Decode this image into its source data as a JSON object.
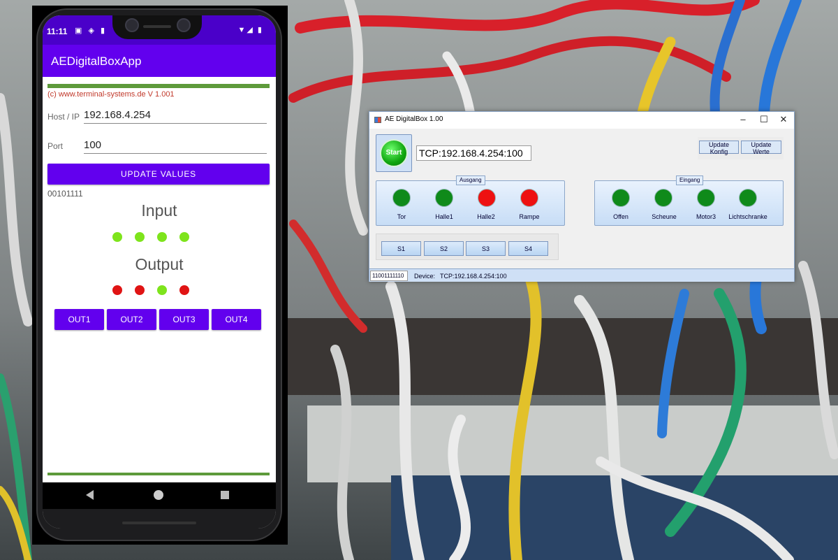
{
  "phone": {
    "status_time": "11:11",
    "status_icons_left": "▣ ◈ ▮",
    "status_icons_right": "▼◢ ▮",
    "app_title": "AEDigitalBoxApp",
    "copyright": "(c) www.terminal-systems.de V 1.001",
    "host_label": "Host / IP",
    "host_value": "192.168.4.254",
    "port_label": "Port",
    "port_value": "100",
    "update_button": "UPDATE VALUES",
    "bits": "00101111",
    "input_title": "Input",
    "output_title": "Output",
    "input_leds": [
      "on",
      "on",
      "on",
      "on"
    ],
    "output_leds": [
      "off",
      "off",
      "on",
      "off"
    ],
    "out_buttons": [
      "OUT1",
      "OUT2",
      "OUT3",
      "OUT4"
    ],
    "colors": {
      "primary": "#6200ee",
      "status": "#4a00c9",
      "accent_line": "#5d9a3b",
      "led_on": "#7ee41c",
      "led_off": "#e01414"
    }
  },
  "window": {
    "title": "AE DigitalBox 1.00",
    "controls": {
      "minimize": "–",
      "maximize": "☐",
      "close": "✕"
    },
    "start_button": "Start",
    "device_address": "TCP:192.168.4.254:100",
    "update_konfig": "Update Konfig",
    "update_werte": "Update Werte",
    "ausgang": {
      "legend": "Ausgang",
      "items": [
        {
          "label": "Tor",
          "state": "green"
        },
        {
          "label": "Halle1",
          "state": "green"
        },
        {
          "label": "Halle2",
          "state": "red"
        },
        {
          "label": "Rampe",
          "state": "red"
        }
      ]
    },
    "eingang": {
      "legend": "Eingang",
      "items": [
        {
          "label": "Offen",
          "state": "green"
        },
        {
          "label": "Scheune",
          "state": "green"
        },
        {
          "label": "Motor3",
          "state": "green"
        },
        {
          "label": "Lichtschranke",
          "state": "green"
        }
      ]
    },
    "switch_buttons": [
      "S1",
      "S2",
      "S3",
      "S4"
    ],
    "status_bits": "11001111110",
    "status_device_label": "Device:",
    "status_device_value": "TCP:192.168.4.254:100",
    "colors": {
      "green": "#0f8a1a",
      "red": "#ee1111"
    }
  }
}
